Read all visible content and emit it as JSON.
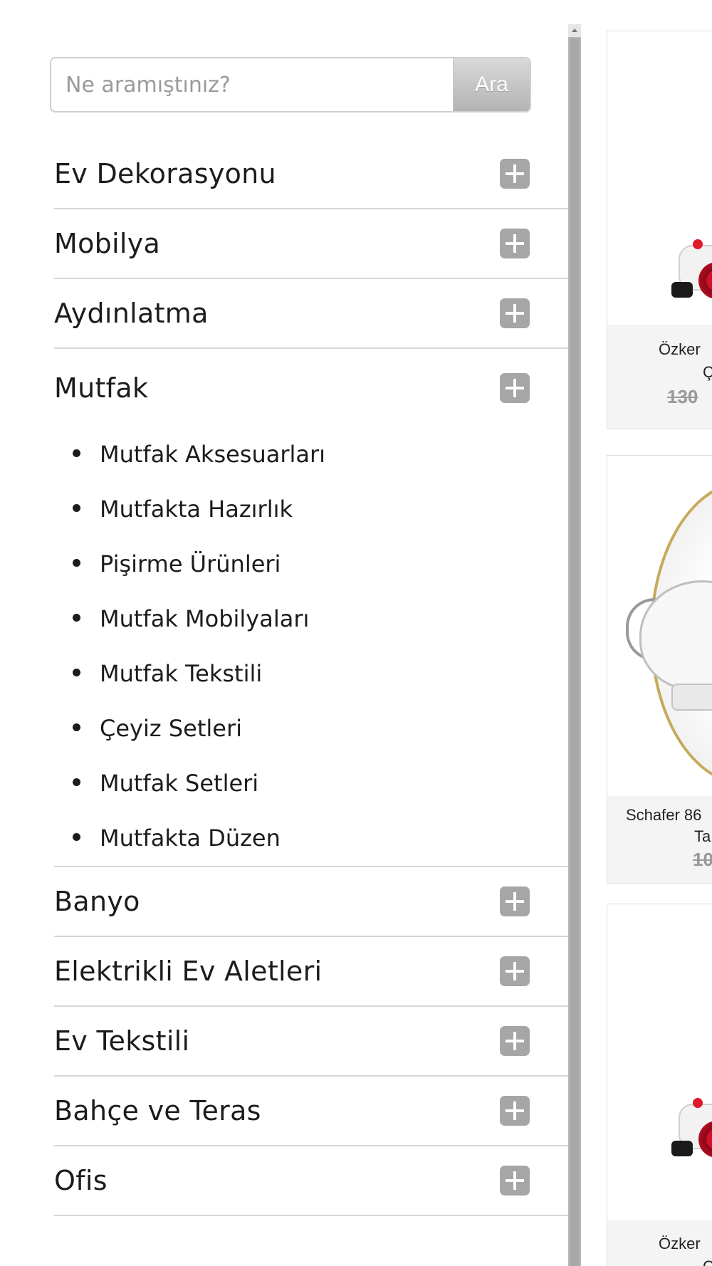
{
  "search": {
    "placeholder": "Ne aramıştınız?",
    "button_label": "Ara"
  },
  "categories": [
    {
      "label": "Ev Dekorasyonu",
      "icon": "plus-icon"
    },
    {
      "label": "Mobilya",
      "icon": "plus-icon"
    },
    {
      "label": "Aydınlatma",
      "icon": "plus-icon"
    },
    {
      "label": "Mutfak",
      "icon": "plus-icon",
      "expanded": true,
      "subcategories": [
        "Mutfak Aksesuarları",
        "Mutfakta Hazırlık",
        "Pişirme Ürünleri",
        "Mutfak Mobilyaları",
        "Mutfak Tekstili",
        "Çeyiz Setleri",
        "Mutfak Setleri",
        "Mutfakta Düzen"
      ]
    },
    {
      "label": "Banyo",
      "icon": "plus-icon"
    },
    {
      "label": "Elektrikli Ev Aletleri",
      "icon": "plus-icon"
    },
    {
      "label": "Ev Tekstili",
      "icon": "plus-icon"
    },
    {
      "label": "Bahçe ve Teras",
      "icon": "plus-icon"
    },
    {
      "label": "Ofis",
      "icon": "plus-icon"
    }
  ],
  "products": [
    {
      "name_line1": "Özker",
      "name_line2": "Ç",
      "old_price": "130"
    },
    {
      "name_line1": "Schafer 86",
      "name_line2": "Ta",
      "old_price": "10"
    },
    {
      "name_line1": "Özker",
      "name_line2": "Ç",
      "old_price": ""
    }
  ],
  "colors": {
    "expand_icon_bg": "#a6a6a6",
    "divider": "#d6d6d6",
    "search_button_gradient_top": "#d9d9d9",
    "search_button_gradient_bottom": "#b3b3b3",
    "scrollbar": "#b8b8b8"
  }
}
